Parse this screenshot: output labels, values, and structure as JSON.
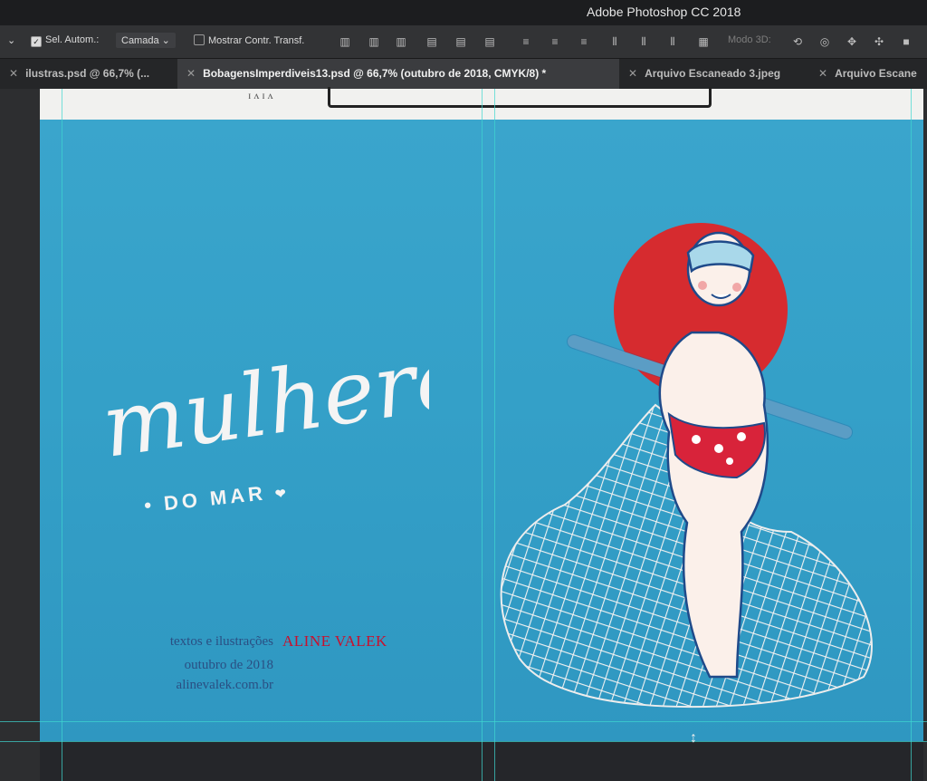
{
  "app": {
    "title": "Adobe Photoshop CC 2018"
  },
  "options_bar": {
    "auto_select_label": "Sel. Autom.:",
    "auto_select_value": "Camada",
    "show_transform_label": "Mostrar Contr. Transf.",
    "mode_3d_label": "Modo 3D:"
  },
  "tabs": [
    {
      "label": "ilustras.psd @ 66,7% (...",
      "active": false
    },
    {
      "label": "BobagensImperdiveis13.psd @ 66,7% (outubro de 2018, CMYK/8) *",
      "active": true
    },
    {
      "label": "Arquivo Escaneado 3.jpeg",
      "active": false
    },
    {
      "label": "Arquivo Escane",
      "active": false
    }
  ],
  "artwork": {
    "title_script": "mulheres",
    "title_caps": "DO MAR",
    "credit_label": "textos e ilustrações",
    "author": "ALINE VALEK",
    "date": "outubro de 2018",
    "website": "alinevalek.com.br"
  },
  "colors": {
    "background_blue": "#35a1c9",
    "author_red": "#c8102e",
    "credit_blue": "#2a4f83",
    "halo_red": "#d62b2f",
    "guide_cyan": "#3fd7d0"
  },
  "icons": [
    "move-tool-options-icon",
    "align-icons",
    "distribute-icons",
    "3d-mode-icons"
  ]
}
